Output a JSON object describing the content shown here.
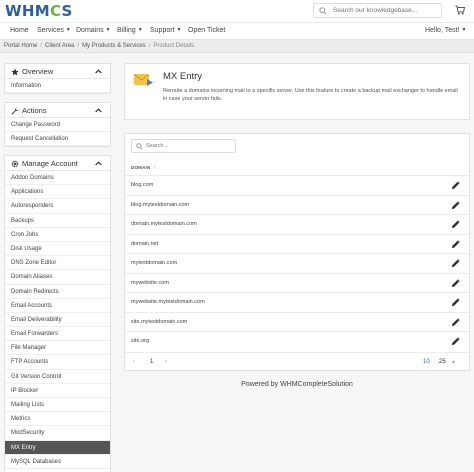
{
  "brand": {
    "logo_text_a": "WHM",
    "logo_text_o": "C",
    "logo_text_b": "S"
  },
  "search": {
    "placeholder": "Search our knowledgebase..."
  },
  "nav": {
    "items": [
      {
        "label": "Home",
        "caret": ""
      },
      {
        "label": "Services",
        "caret": "▼"
      },
      {
        "label": "Domains",
        "caret": "▼"
      },
      {
        "label": "Billing",
        "caret": "▼"
      },
      {
        "label": "Support",
        "caret": "▼"
      },
      {
        "label": "Open Ticket",
        "caret": ""
      }
    ],
    "user": {
      "label": "Hello, Test!",
      "caret": "▼"
    }
  },
  "breadcrumb": [
    "Portal Home",
    "Client Area",
    "My Products & Services",
    "Product Details"
  ],
  "sidebar": {
    "overview": {
      "title": "Overview",
      "items": [
        "Information"
      ]
    },
    "actions": {
      "title": "Actions",
      "items": [
        "Change Password",
        "Request Cancellation"
      ]
    },
    "manage": {
      "title": "Manage Account",
      "items": [
        "Addon Domains",
        "Applications",
        "Autoresponders",
        "Backups",
        "Cron Jobs",
        "Disk Usage",
        "DNS Zone Editor",
        "Domain Aliases",
        "Domain Redirects",
        "Email Accounts",
        "Email Deliverability",
        "Email Forwarders",
        "File Manager",
        "FTP Accounts",
        "Git Version Control",
        "IP Blocker",
        "Mailing Lists",
        "Metrics",
        "ModSecurity",
        "MX Entry",
        "MySQL Databases"
      ],
      "active": "MX Entry"
    }
  },
  "mx": {
    "title": "MX Entry",
    "description": "Reroute a domains incoming mail to a specific server. Use this feature to create a backup mail exchanger to handle email in case your server fails."
  },
  "table": {
    "search_placeholder": "Search...",
    "column": "DOMAIN",
    "sort_icon": "↑",
    "rows": [
      "blog.com",
      "blog.mytestdomain.com",
      "domain.mytestdomain.com",
      "domain.net",
      "mytestdomain.com",
      "mywebsite.com",
      "mywebsite.mytestdomain.com",
      "site.mytestdomain.com",
      "site.org"
    ],
    "pager": {
      "prev": "‹",
      "page": "1",
      "next": "›",
      "size_10": "10",
      "size_25": "25",
      "dropdown": "▾"
    }
  },
  "footer": {
    "powered": "Powered by WHMCompleteSolution"
  }
}
